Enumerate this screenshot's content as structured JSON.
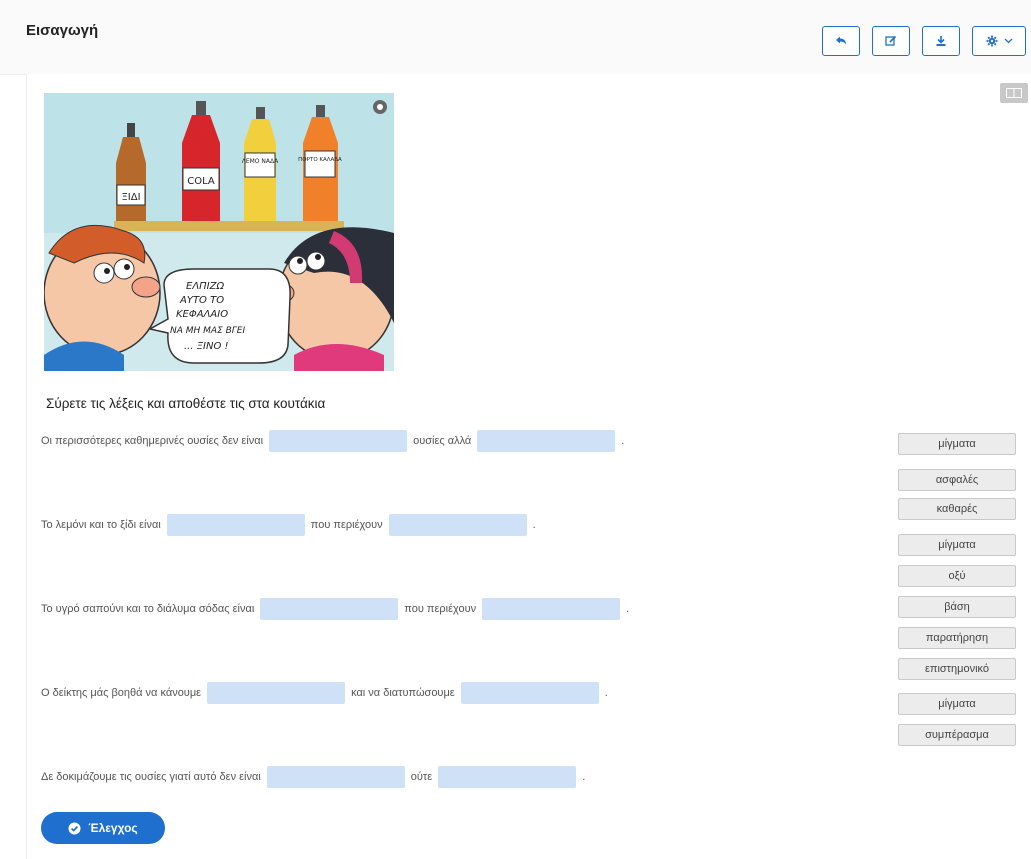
{
  "header": {
    "title": "Εισαγωγή",
    "toolbar": [
      {
        "name": "undo",
        "icon": "undo-icon"
      },
      {
        "name": "edit",
        "icon": "edit-icon"
      },
      {
        "name": "download",
        "icon": "download-icon"
      },
      {
        "name": "settings",
        "icon": "gear-icon"
      }
    ]
  },
  "image": {
    "bottles": [
      "ΞΙΔΙ",
      "COLA",
      "ΛΕΜΟ ΝΑΔΑ",
      "ΠΟΡΤΟ ΚΑΛΑΔΑ"
    ],
    "speech": [
      "ΕΛΠΙΖΩ",
      "ΑΥΤΟ ΤΟ",
      "ΚΕΦΑΛΑΙΟ",
      "ΝΑ ΜΗ ΜΑΣ ΒΓΕΙ",
      "... ΞΙΝΟ !"
    ]
  },
  "instruction": "Σύρετε τις λέξεις και αποθέστε τις στα κουτάκια",
  "sentences": [
    {
      "before": "Οι περισσότερες καθημερινές ουσίες δεν είναι",
      "middle": "ουσίες αλλά",
      "after": "."
    },
    {
      "before": "Το λεμόνι και το ξίδι είναι",
      "middle": "που περιέχουν",
      "after": "."
    },
    {
      "before": "Το υγρό σαπούνι και το διάλυμα σόδας είναι",
      "middle": "που περιέχουν",
      "after": "."
    },
    {
      "before": "Ο δείκτης μάς βοηθά να κάνουμε",
      "middle": "και να διατυπώσουμε",
      "after": "."
    },
    {
      "before": "Δε δοκιμάζουμε τις ουσίες γιατί αυτό δεν είναι",
      "middle": "ούτε",
      "after": "."
    }
  ],
  "word_bank": [
    "μίγματα",
    "ασφαλές",
    "καθαρές",
    "μίγματα",
    "οξύ",
    "βάση",
    "παρατήρηση",
    "επιστημονικό",
    "μίγματα",
    "συμπέρασμα"
  ],
  "check_button": {
    "label": "Έλεγχος"
  },
  "colors": {
    "accent": "#1f6fcf",
    "drop_zone": "#cfe1f7",
    "word_bg": "#ececec"
  }
}
